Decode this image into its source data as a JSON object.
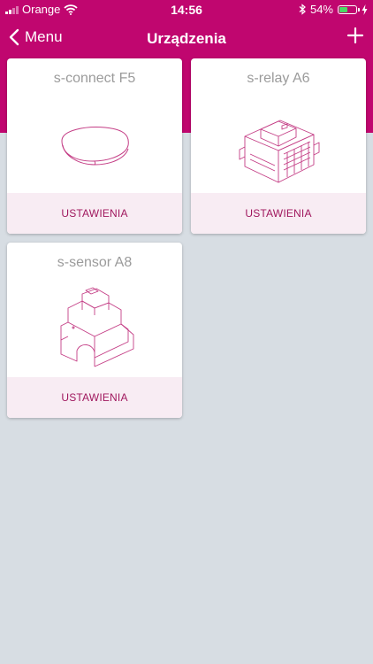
{
  "status_bar": {
    "carrier": "Orange",
    "time": "14:56",
    "battery": "54%",
    "battery_level": 0.54,
    "icons": [
      "signal-icon",
      "wifi-icon",
      "bluetooth-icon",
      "battery-icon",
      "charging-icon"
    ]
  },
  "nav": {
    "back_label": "Menu",
    "title": "Urządzenia",
    "add_icon": "plus-icon"
  },
  "devices": [
    {
      "name": "s-connect F5",
      "settings_label": "USTAWIENIA",
      "image": "hub-device-image"
    },
    {
      "name": "s-relay A6",
      "settings_label": "USTAWIENIA",
      "image": "relay-device-image"
    },
    {
      "name": "s-sensor A8",
      "settings_label": "USTAWIENIA",
      "image": "sensor-device-image"
    }
  ],
  "colors": {
    "brand": "#c0066f",
    "background": "#d7dde3",
    "card_footer": "#f8ecf3",
    "footer_text": "#a0185e",
    "line_art": "#c43d85",
    "battery_fill": "#4cd964"
  }
}
